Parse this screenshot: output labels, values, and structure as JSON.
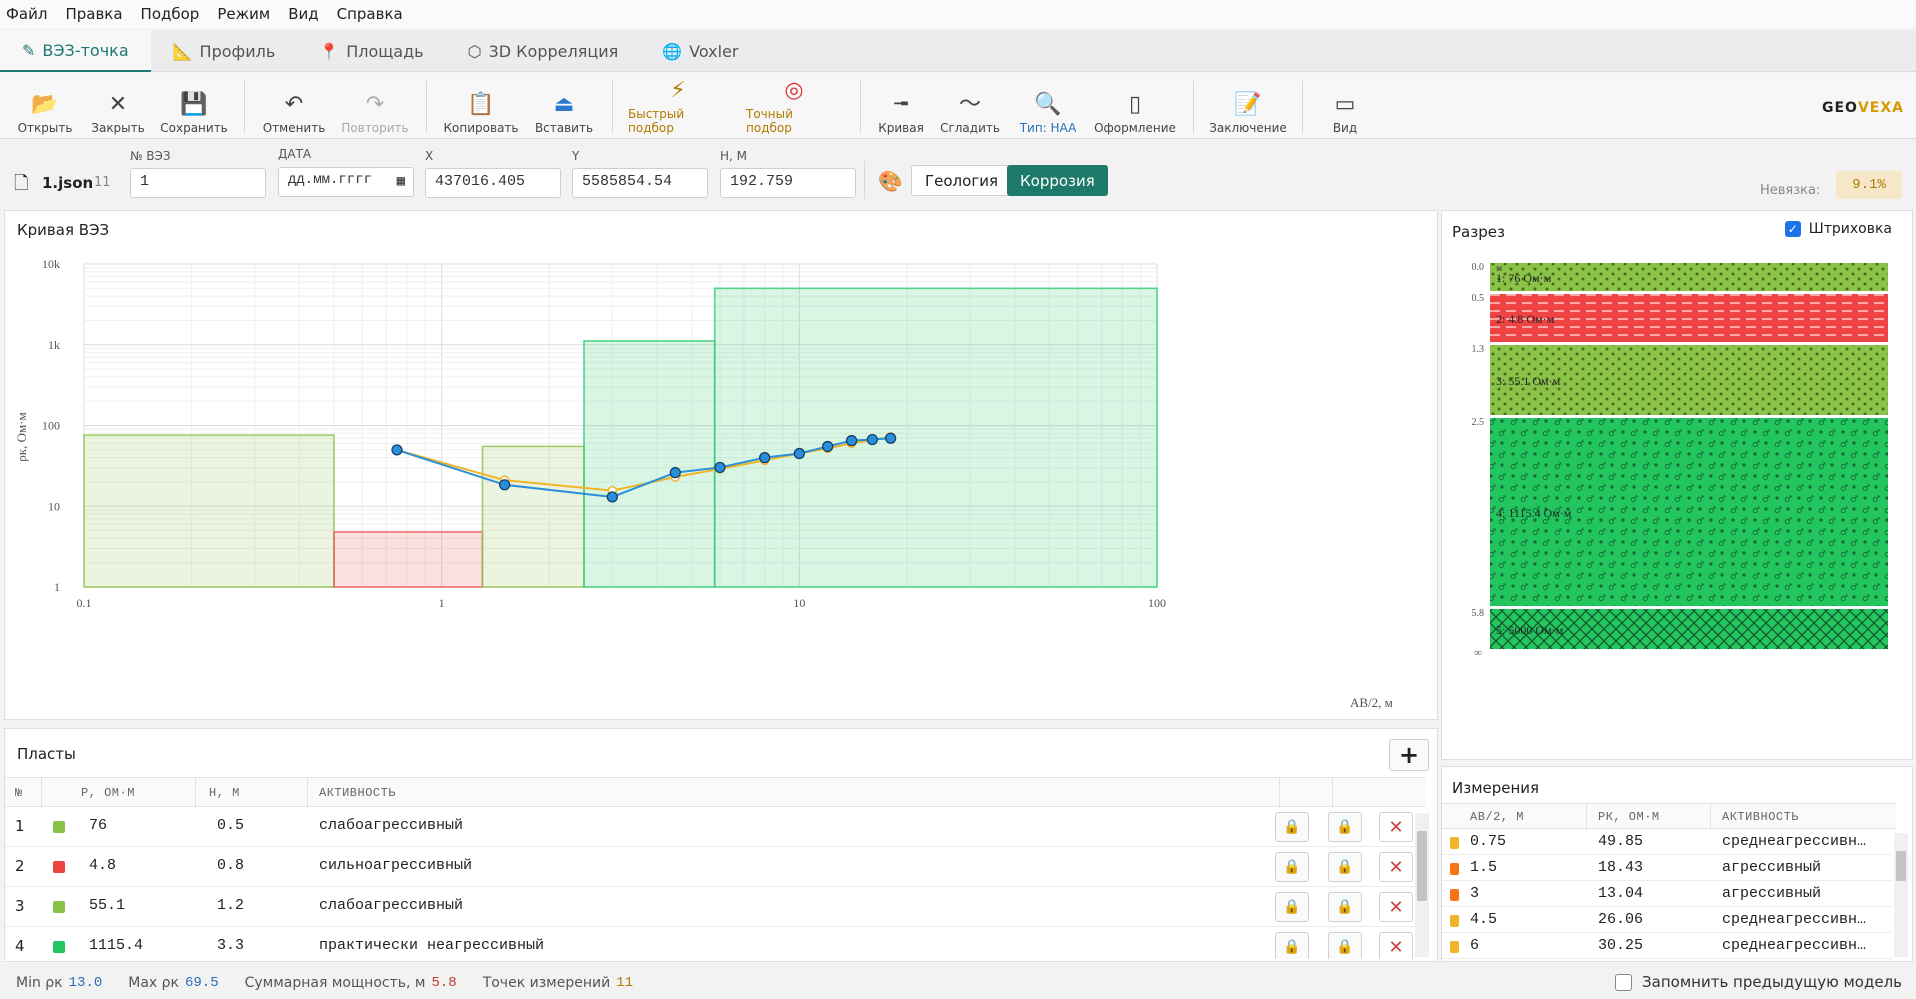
{
  "menu": [
    "Файл",
    "Правка",
    "Подбор",
    "Режим",
    "Вид",
    "Справка"
  ],
  "tabs": [
    {
      "label": "ВЭЗ-точка",
      "icon": "pencil-icon",
      "glyph": "✎"
    },
    {
      "label": "Профиль",
      "icon": "ruler-icon",
      "glyph": "📐"
    },
    {
      "label": "Площадь",
      "icon": "pin-icon",
      "glyph": "📍"
    },
    {
      "label": "3D Корреляция",
      "icon": "cube-icon",
      "glyph": "⬡"
    },
    {
      "label": "Voxler",
      "icon": "globe-icon",
      "glyph": "🌐"
    }
  ],
  "toolbar": {
    "open": "Открыть",
    "close": "Закрыть",
    "save": "Сохранить",
    "undo": "Отменить",
    "redo": "Повторить",
    "copy": "Копировать",
    "paste": "Вставить",
    "quick_fit": "Быстрый подбор",
    "exact_fit": "Точный подбор",
    "curve": "Кривая",
    "smooth": "Сгладить",
    "type": "Тип: HAA",
    "design": "Оформление",
    "conclusion": "Заключение",
    "view": "Вид"
  },
  "brand": {
    "geo": "GEO",
    "vexa": "VEXA"
  },
  "fields": {
    "file_name": "1.json",
    "file_count": "11",
    "vez_label": "№ ВЭЗ",
    "vez_value": "1",
    "date_label": "ДАТА",
    "date_value": "дд.мм.гггг",
    "x_label": "X",
    "x_value": "437016.405",
    "y_label": "Y",
    "y_value": "5585854.54",
    "h_label": "H, М",
    "h_value": "192.759",
    "geology": "Геология",
    "corrosion": "Коррозия",
    "misfit_label": "Невязка:",
    "misfit_value": "9.1%"
  },
  "curve_panel": {
    "title": "Кривая ВЭЗ"
  },
  "chart_data": {
    "type": "line",
    "xscale": "log",
    "yscale": "log",
    "xlim": [
      0.1,
      100
    ],
    "ylim": [
      1,
      10000
    ],
    "xticks": [
      "0.1",
      "1",
      "10",
      "100"
    ],
    "yticks": [
      "1",
      "10",
      "100",
      "1k",
      "10k"
    ],
    "xlabel": "AB/2, м",
    "ylabel": "ρк, Ом·м",
    "grid": true,
    "layers": [
      {
        "x0": 0.1,
        "x1": 0.5,
        "rho": 76,
        "color": "#8bc34a"
      },
      {
        "x0": 0.5,
        "x1": 1.3,
        "rho": 4.8,
        "color": "#ef5350"
      },
      {
        "x0": 1.3,
        "x1": 2.5,
        "rho": 55.1,
        "color": "#8bc34a"
      },
      {
        "x0": 2.5,
        "x1": 5.8,
        "rho": 1115.4,
        "color": "#2ecc71"
      },
      {
        "x0": 5.8,
        "x1": 100,
        "rho": 5000,
        "color": "#2ecc71"
      }
    ],
    "series": [
      {
        "color": "#f0b429",
        "x": [
          0.75,
          1.5,
          3,
          4.5,
          6,
          8,
          10,
          12,
          14,
          16,
          18
        ],
        "values": [
          49.85,
          21,
          15.6,
          23,
          29,
          37,
          45,
          52,
          60,
          66,
          72
        ]
      },
      {
        "color": "#2a8fd6",
        "x": [
          0.75,
          1.5,
          3,
          4.5,
          6,
          8,
          10,
          12,
          14,
          16,
          18
        ],
        "values": [
          49.85,
          18.43,
          13.04,
          26.06,
          30.25,
          40,
          45,
          55,
          65,
          67,
          69.5
        ]
      }
    ]
  },
  "section": {
    "title": "Разрез",
    "hatch_label": "Штриховка",
    "unit": "м",
    "depths": [
      "0.0",
      "0.5",
      "1.3",
      "2.5",
      "5.8",
      "∞"
    ],
    "layers": [
      {
        "label": "1: 76 Ом·м",
        "color": "#8bc34a",
        "pattern": "dots",
        "thickness": 0.5
      },
      {
        "label": "2: 4.8 Ом·м",
        "color": "#ef4444",
        "pattern": "dashes",
        "thickness": 0.8
      },
      {
        "label": "3: 55.1 Ом·м",
        "color": "#8bc34a",
        "pattern": "dots",
        "thickness": 1.2
      },
      {
        "label": "4: 1115.4 Ом·м",
        "color": "#22c55e",
        "pattern": "symbols",
        "thickness": 3.3
      },
      {
        "label": "5: 5000 Ом·м",
        "color": "#22c55e",
        "pattern": "cross",
        "thickness": 0.7
      }
    ]
  },
  "layers_panel": {
    "title": "Пласты",
    "headers": [
      "№",
      "",
      "Р, ОМ·М",
      "Н, М",
      "АКТИВНОСТЬ"
    ],
    "rows": [
      {
        "n": "1",
        "color": "#8bc34a",
        "rho": "76",
        "h": "0.5",
        "act": "слабоагрессивный"
      },
      {
        "n": "2",
        "color": "#ef4444",
        "rho": "4.8",
        "h": "0.8",
        "act": "сильноагрессивный"
      },
      {
        "n": "3",
        "color": "#8bc34a",
        "rho": "55.1",
        "h": "1.2",
        "act": "слабоагрессивный"
      },
      {
        "n": "4",
        "color": "#22c55e",
        "rho": "1115.4",
        "h": "3.3",
        "act": "практически неагрессивный"
      }
    ]
  },
  "measure_panel": {
    "title": "Измерения",
    "headers": [
      "АВ/2, М",
      "РК, ОМ·М",
      "АКТИВНОСТЬ"
    ],
    "rows": [
      {
        "color": "#f0b429",
        "ab": "0.75",
        "rk": "49.85",
        "act": "среднеагрессивн…"
      },
      {
        "color": "#f97316",
        "ab": "1.5",
        "rk": "18.43",
        "act": "агрессивный"
      },
      {
        "color": "#f97316",
        "ab": "3",
        "rk": "13.04",
        "act": "агрессивный"
      },
      {
        "color": "#f0b429",
        "ab": "4.5",
        "rk": "26.06",
        "act": "среднеагрессивн…"
      },
      {
        "color": "#f0b429",
        "ab": "6",
        "rk": "30.25",
        "act": "среднеагрессивн…"
      }
    ]
  },
  "status": {
    "min_label": "Min ρк",
    "min_value": "13.0",
    "max_label": "Max ρк",
    "max_value": "69.5",
    "total_label": "Суммарная мощность, м",
    "total_value": "5.8",
    "points_label": "Точек измерений",
    "points_value": "11",
    "remember_label": "Запомнить предыдущую модель"
  }
}
